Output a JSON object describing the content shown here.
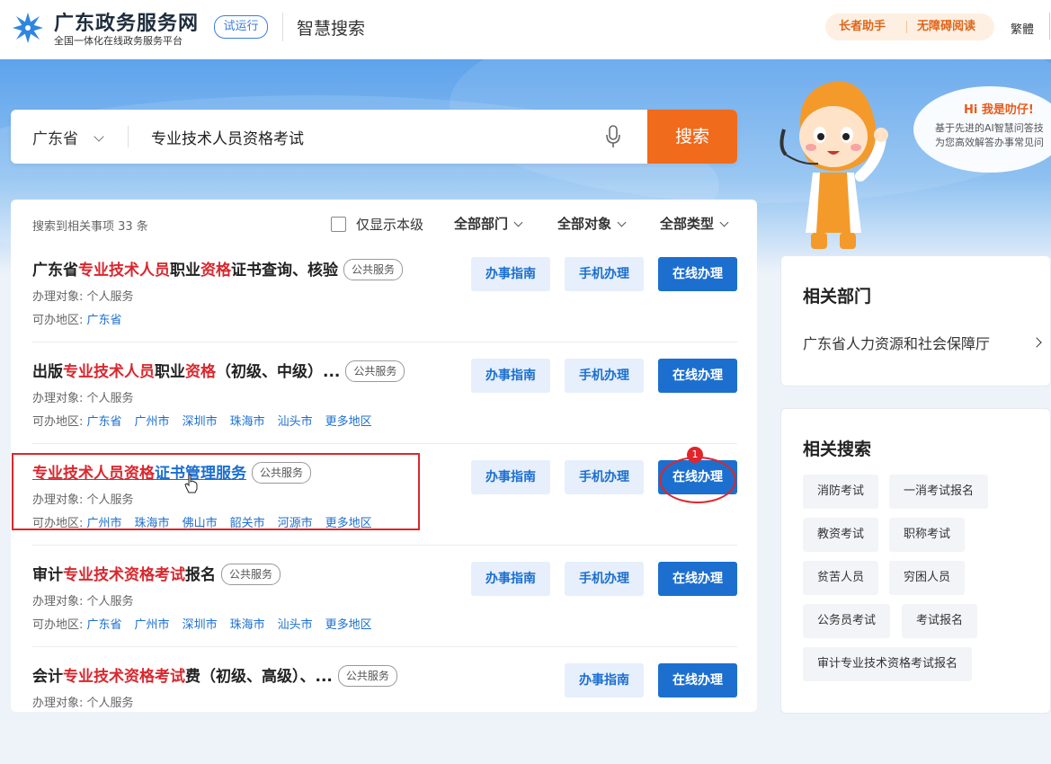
{
  "header": {
    "site_title": "广东政务服务网",
    "site_subtitle": "全国一体化在线政务服务平台",
    "beta_label": "试运行",
    "page_name": "智慧搜索",
    "elder_mode": "长者助手",
    "accessibility": "无障碍阅读",
    "traditional": "繁體"
  },
  "search": {
    "province": "广东省",
    "query": "专业技术人员资格考试",
    "button": "搜索"
  },
  "assistant": {
    "greeting": "Hi 我是叻仔!",
    "line1": "基于先进的AI智慧问答技",
    "line2": "为您高效解答办事常见问"
  },
  "results": {
    "count_text": "搜索到相关事项 33 条",
    "only_this_level": "仅显示本级",
    "filters": [
      "全部部门",
      "全部对象",
      "全部类型"
    ],
    "target_label": "办理对象:",
    "region_label": "可办地区:",
    "guide_label": "办事指南",
    "mobile_label": "手机办理",
    "online_label": "在线办理",
    "badge_count": "1",
    "items": [
      {
        "title_parts": [
          "广东省",
          "专业技术人员",
          "职业",
          "资格",
          "证书查询、核验"
        ],
        "tag": "公共服务",
        "target": "个人服务",
        "regions": [
          "广东省"
        ]
      },
      {
        "title_parts": [
          "出版",
          "专业技术人员",
          "职业",
          "资格",
          "（初级、中级）..."
        ],
        "tag": "公共服务",
        "target": "个人服务",
        "regions": [
          "广东省",
          "广州市",
          "深圳市",
          "珠海市",
          "汕头市",
          "更多地区"
        ]
      },
      {
        "title_parts": [
          "",
          "专业技术人员资格",
          "证书管理服务"
        ],
        "tag": "公共服务",
        "target": "个人服务",
        "regions": [
          "广州市",
          "珠海市",
          "佛山市",
          "韶关市",
          "河源市",
          "更多地区"
        ]
      },
      {
        "title_parts": [
          "审计",
          "专业技术资格考试",
          "报名"
        ],
        "tag": "公共服务",
        "target": "个人服务",
        "regions": [
          "广东省",
          "广州市",
          "深圳市",
          "珠海市",
          "汕头市",
          "更多地区"
        ]
      },
      {
        "title_parts": [
          "会计",
          "专业技术资格考试",
          "费（初级、高级）、..."
        ],
        "tag": "公共服务",
        "target": "个人服务",
        "regions": []
      }
    ]
  },
  "sidebar": {
    "dept_title": "相关部门",
    "dept_name": "广东省人力资源和社会保障厅",
    "related_title": "相关搜索",
    "related": [
      "消防考试",
      "一消考试报名",
      "教资考试",
      "职称考试",
      "贫苦人员",
      "穷困人员",
      "公务员考试",
      "考试报名",
      "审计专业技术资格考试报名"
    ]
  },
  "colors": {
    "accent_blue": "#1c6fcf",
    "search_orange": "#f06b1c",
    "highlight_red": "#d9272e"
  }
}
